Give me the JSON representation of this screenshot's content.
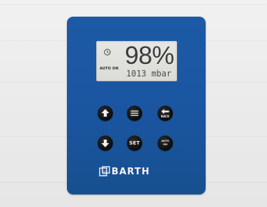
{
  "display": {
    "percent": "98%",
    "pressure": "1013 mbar",
    "mode": "AUTO ON",
    "status_icon": "clock-icon"
  },
  "keys": {
    "up": {
      "icon": "arrow-up-icon"
    },
    "menu": {
      "icon": "menu-lines-icon"
    },
    "back": {
      "icon": "arrow-left-icon",
      "label": "BACK"
    },
    "down": {
      "icon": "arrow-down-icon"
    },
    "set": {
      "label": "SET"
    },
    "auto": {
      "line1": "AUTO",
      "line2": "ON"
    }
  },
  "brand": {
    "name": "BARTH",
    "logo": "barth-logo-icon"
  },
  "colors": {
    "panel": "#1a55a0",
    "lcd": "#e0e0dc",
    "key": "#111111",
    "key_symbol": "#f2f2f2"
  }
}
